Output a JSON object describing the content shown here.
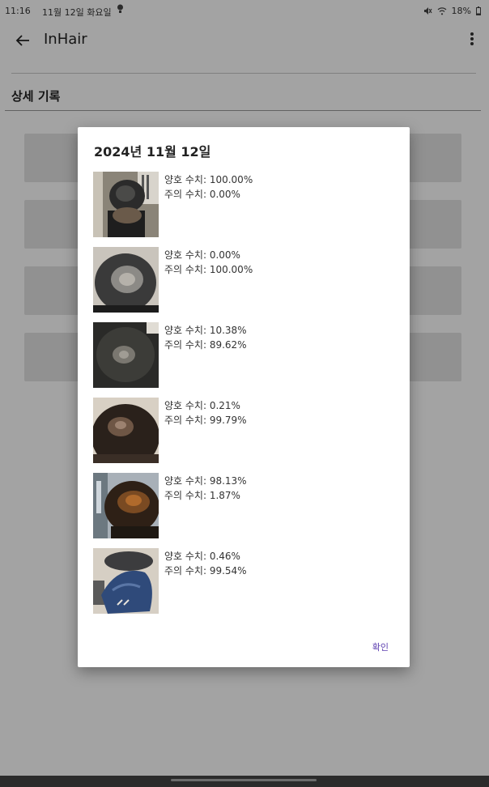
{
  "status_bar": {
    "time": "11:16",
    "date": "11월 12일 화요일",
    "battery": "18%"
  },
  "app_bar": {
    "title": "InHair"
  },
  "section_title": "상세 기록",
  "dialog": {
    "title": "2024년 11월 12일",
    "confirm_label": "확인",
    "records": [
      {
        "good": "양호 수치: 100.00%",
        "caution": "주의 수치: 0.00%"
      },
      {
        "good": "양호 수치: 0.00%",
        "caution": "주의 수치: 100.00%"
      },
      {
        "good": "양호 수치: 10.38%",
        "caution": "주의 수치: 89.62%"
      },
      {
        "good": "양호 수치: 0.21%",
        "caution": "주의 수치: 99.79%"
      },
      {
        "good": "양호 수치: 98.13%",
        "caution": "주의 수치: 1.87%"
      },
      {
        "good": "양호 수치: 0.46%",
        "caution": "주의 수치: 99.54%"
      }
    ]
  },
  "colors": {
    "accent": "#5d3fb0",
    "scrim": "rgba(0,0,0,0.36)",
    "card": "#e3e3e3"
  }
}
